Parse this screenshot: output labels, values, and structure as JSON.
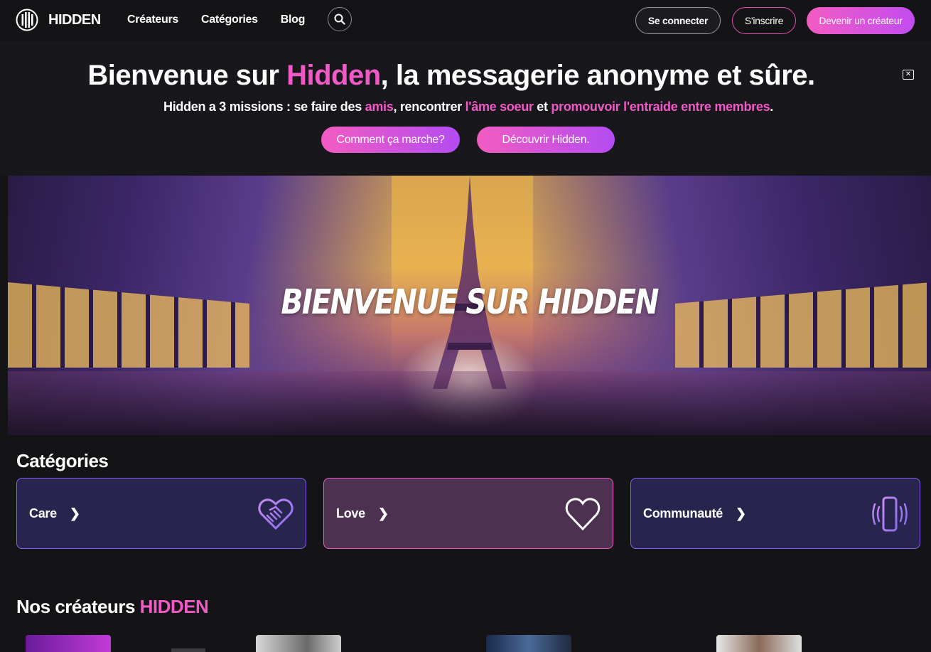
{
  "header": {
    "logo_text": "HIDDEN",
    "nav": [
      "Créateurs",
      "Catégories",
      "Blog"
    ],
    "login_label": "Se connecter",
    "signup_label": "S'inscrire",
    "creator_label": "Devenir un créateur"
  },
  "banner": {
    "title_part1": "Bienvenue sur ",
    "title_highlight": "Hidden",
    "title_part2": ", la messagerie anonyme et sûre.",
    "subtitle_part1": "Hidden a 3 missions : se faire des ",
    "subtitle_hl1": "amis",
    "subtitle_part2": ", rencontrer ",
    "subtitle_hl2": "l'âme soeur",
    "subtitle_part3": " et ",
    "subtitle_hl3": "promouvoir l'entraide entre membres",
    "subtitle_part4": ".",
    "button1": "Comment ça marche?",
    "button2": "Découvrir Hidden."
  },
  "hero": {
    "title": "BIENVENUE SUR HIDDEN"
  },
  "categories": {
    "title": "Catégories",
    "items": [
      {
        "label": "Care",
        "icon": "handshake-heart-icon"
      },
      {
        "label": "Love",
        "icon": "heart-icon"
      },
      {
        "label": "Communauté",
        "icon": "phone-vibrate-icon"
      }
    ]
  },
  "creators": {
    "title_part1": "Nos créateurs ",
    "title_highlight": "HIDDEN"
  },
  "colors": {
    "accent_pink": "#f05ac6",
    "accent_purple": "#b44cf2",
    "background": "#141316"
  }
}
